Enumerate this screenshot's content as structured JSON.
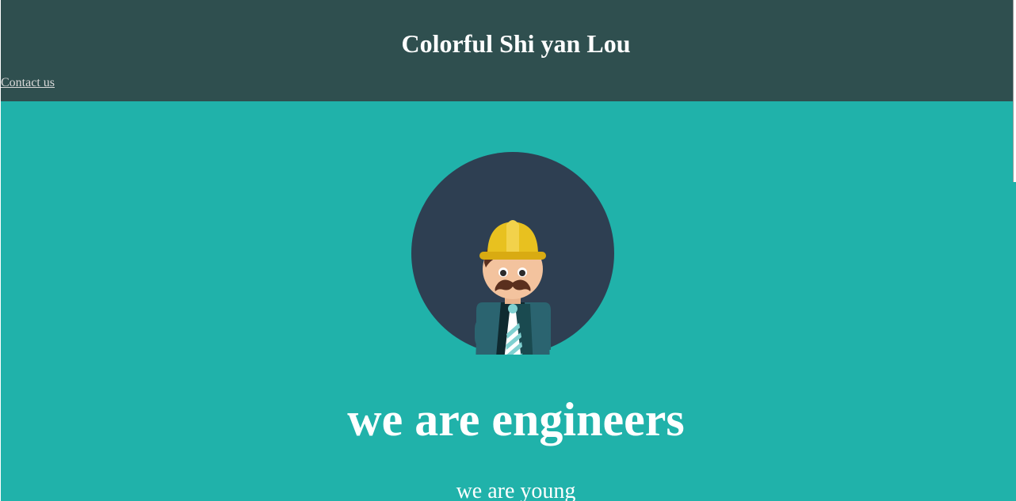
{
  "header": {
    "title": "Colorful Shi yan Lou",
    "contact_link": "Contact us"
  },
  "hero": {
    "avatar_icon": "engineer-avatar-icon",
    "heading": "we are engineers",
    "subheading": "we are young"
  },
  "colors": {
    "header_bg": "#2f4f4f",
    "hero_bg": "#20b2aa",
    "avatar_circle": "#2e3f52",
    "helmet": "#e8c11f",
    "text": "#ffffff"
  }
}
